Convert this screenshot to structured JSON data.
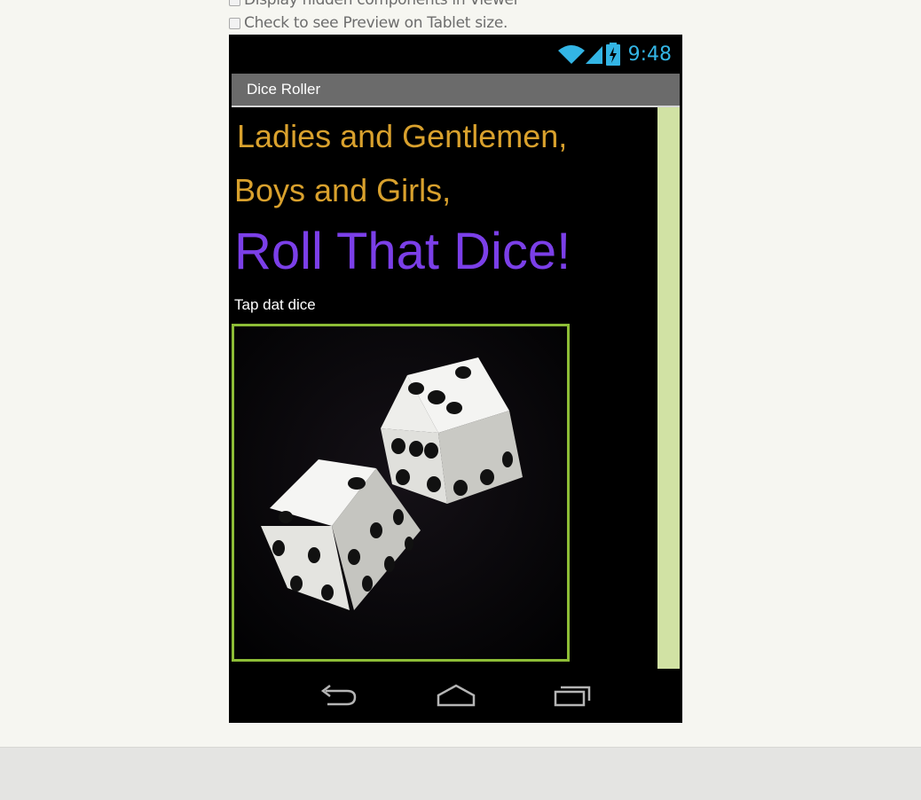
{
  "options": {
    "hidden_components_label": "Display hidden components in Viewer",
    "tablet_preview_label": "Check to see Preview on Tablet size."
  },
  "status_bar": {
    "time": "9:48",
    "icons": [
      "wifi-icon",
      "signal-icon",
      "battery-charging-icon"
    ],
    "accent_color": "#33b5e5"
  },
  "app": {
    "title": "Dice Roller",
    "labels": [
      {
        "text": "Ladies and Gentlemen,",
        "color": "#d9a12d"
      },
      {
        "text": "Boys and Girls,",
        "color": "#d9a12d"
      },
      {
        "text": "Roll That Dice!",
        "color": "#7b3fe8"
      },
      {
        "text": "Tap dat dice",
        "color": "#ffffff"
      }
    ],
    "dice_image": "two-white-dice-image",
    "selection_color": "#8dbd36"
  },
  "nav_bar": {
    "buttons": [
      "back-icon",
      "home-icon",
      "recent-apps-icon"
    ]
  }
}
